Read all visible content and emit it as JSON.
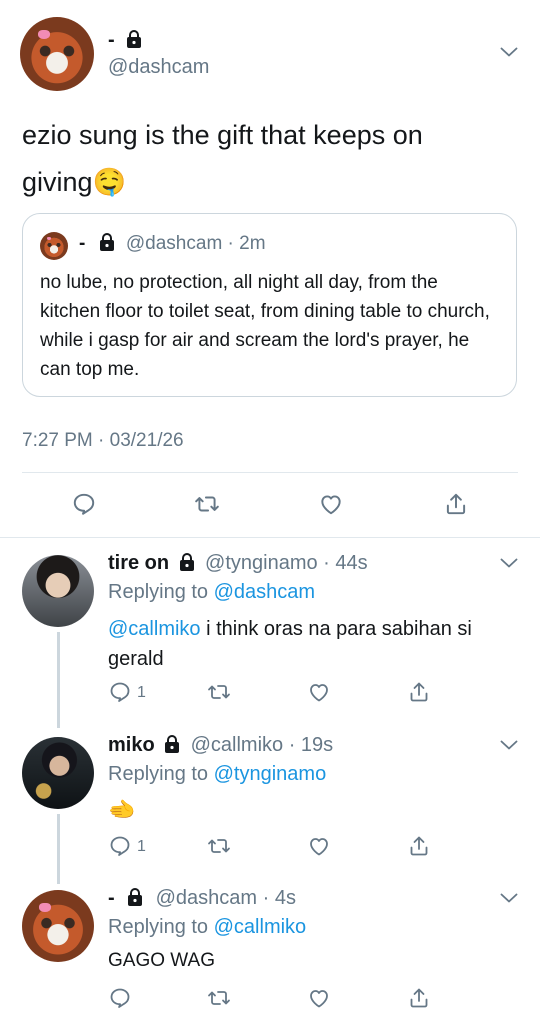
{
  "main_tweet": {
    "display_name": "-",
    "handle": "@dashcam",
    "text": "ezio sung is the gift that keeps on giving🤤",
    "quote": {
      "display_name": "-",
      "handle": "@dashcam",
      "time": "2m",
      "text": "no lube, no protection, all night all day, from the kitchen floor to toilet seat, from dining table to church, while i gasp for air and scream the lord's prayer, he can top me."
    },
    "timestamp": "7:27 PM · 03/21/26"
  },
  "replies": [
    {
      "display_name": "tire on",
      "handle": "@tynginamo",
      "time": "44s",
      "replying_label": "Replying to",
      "replying_to": "@dashcam",
      "mention": "@callmiko",
      "text": " i think oras na para sabihan si gerald",
      "reply_count": "1"
    },
    {
      "display_name": "miko",
      "handle": "@callmiko",
      "time": "19s",
      "replying_label": "Replying to",
      "replying_to": "@tynginamo",
      "text": "🫲",
      "reply_count": "1"
    },
    {
      "display_name": "-",
      "handle": "@dashcam",
      "time": "4s",
      "replying_label": "Replying to",
      "replying_to": "@callmiko",
      "text": "GAGO WAG",
      "reply_count": ""
    }
  ],
  "colors": {
    "link": "#1b95e0",
    "muted": "#657786",
    "text": "#14171a",
    "divider": "#e1e8ed"
  },
  "icons": [
    "lock-icon",
    "chevron-down-icon",
    "reply-icon",
    "retweet-icon",
    "like-icon",
    "share-icon"
  ]
}
